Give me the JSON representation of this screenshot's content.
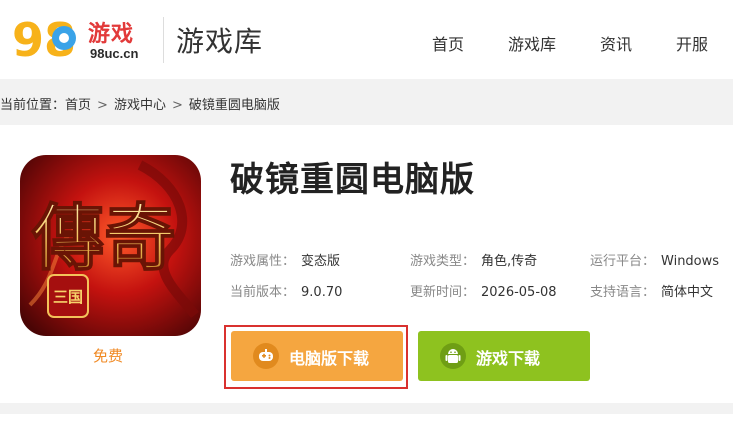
{
  "header": {
    "logo_brand": "游戏",
    "logo_domain": "98uc.cn",
    "logo_digits": "98",
    "title": "游戏库",
    "nav": [
      "首页",
      "游戏库",
      "资讯",
      "开服"
    ]
  },
  "breadcrumb": {
    "prefix": "当前位置：",
    "items": [
      "首页",
      "游戏中心",
      "破镜重圆电脑版"
    ]
  },
  "game": {
    "title": "破镜重圆电脑版",
    "icon_text": "傳奇",
    "icon_badge": "三国",
    "price_label": "免费",
    "attributes": [
      {
        "label": "游戏属性：",
        "value": "变态版"
      },
      {
        "label": "游戏类型：",
        "value": "角色,传奇"
      },
      {
        "label": "运行平台：",
        "value": "Windows"
      },
      {
        "label": "当前版本：",
        "value": "9.0.70"
      },
      {
        "label": "更新时间：",
        "value": "2026-05-08"
      },
      {
        "label": "支持语言：",
        "value": "简体中文"
      }
    ]
  },
  "buttons": {
    "pc_download": "电脑版下载",
    "game_download": "游戏下载"
  },
  "icons": {
    "pc_button": "gamepad-icon",
    "game_button": "android-icon"
  },
  "colors": {
    "pc_button": "#f5a640",
    "game_button": "#8ec21f",
    "highlight": "#d9312f",
    "brand": "#e23a3a",
    "price": "#f08a24"
  }
}
